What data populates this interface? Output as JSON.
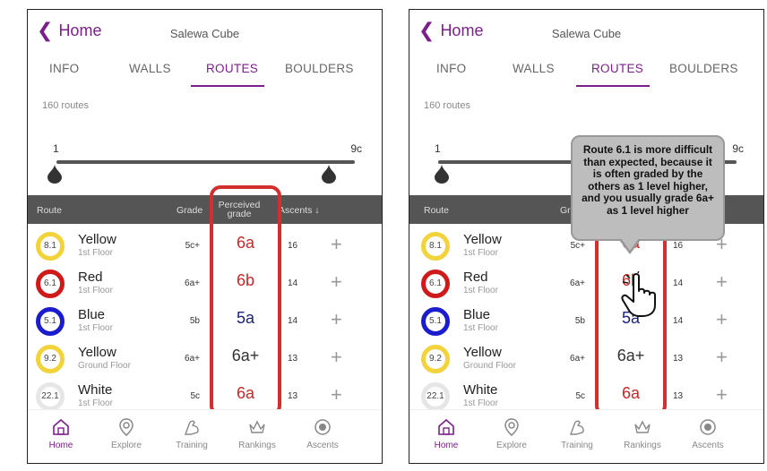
{
  "header": {
    "back_label": "Home",
    "gym_name": "Salewa Cube"
  },
  "tabs": [
    {
      "label": "INFO"
    },
    {
      "label": "WALLS"
    },
    {
      "label": "ROUTES",
      "active": true
    },
    {
      "label": "BOULDERS"
    }
  ],
  "route_count": "160 routes",
  "grade_filter": {
    "min_label": "1",
    "max_label": "9c"
  },
  "table_header": {
    "route": "Route",
    "grade": "Grade",
    "perceived": "Perceived\ngrade",
    "ascents": "Ascents ↓"
  },
  "routes": [
    {
      "ring_label": "8.1",
      "ring_color": "#f2d33c",
      "name": "Yellow",
      "floor": "1st Floor",
      "grade": "5c+",
      "perceived": "6a",
      "perceived_color": "#c62828",
      "ascents": "16"
    },
    {
      "ring_label": "6.1",
      "ring_color": "#d01a1a",
      "name": "Red",
      "floor": "1st Floor",
      "grade": "6a+",
      "perceived": "6b",
      "perceived_color": "#c62828",
      "ascents": "14"
    },
    {
      "ring_label": "5.1",
      "ring_color": "#1c1ccf",
      "name": "Blue",
      "floor": "1st Floor",
      "grade": "5b",
      "perceived": "5a",
      "perceived_color": "#1a237e",
      "ascents": "14"
    },
    {
      "ring_label": "9.2",
      "ring_color": "#f2d33c",
      "name": "Yellow",
      "floor": "Ground Floor",
      "grade": "6a+",
      "perceived": "6a+",
      "perceived_color": "#333333",
      "ascents": "13"
    },
    {
      "ring_label": "22.1",
      "ring_color": "#e6e6e6",
      "name": "White",
      "floor": "1st Floor",
      "grade": "5c",
      "perceived": "6a",
      "perceived_color": "#c62828",
      "ascents": "13"
    }
  ],
  "nav": [
    {
      "label": "Home",
      "icon": "home-icon",
      "active": true
    },
    {
      "label": "Explore",
      "icon": "location-pin-icon"
    },
    {
      "label": "Training",
      "icon": "flexed-arm-icon"
    },
    {
      "label": "Rankings",
      "icon": "crown-icon"
    },
    {
      "label": "Ascents",
      "icon": "target-icon"
    }
  ],
  "tooltip_text": "Route 6.1 is more difficult than expected, because it is often graded by the others as 1 level higher, and you usually grade 6a+ as 1 level higher",
  "colors": {
    "accent": "#7b1f8a",
    "highlight": "#d32f2f",
    "header_bg": "#555555"
  }
}
